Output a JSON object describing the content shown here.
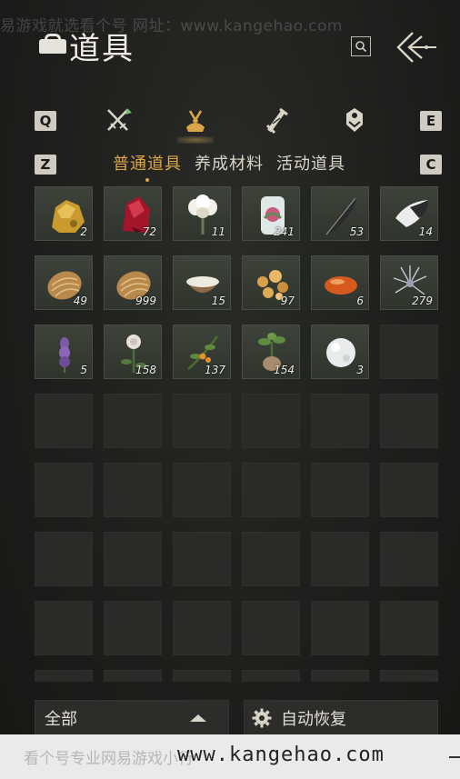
{
  "watermark_top": "易游戏就选看个号    网址：www.kangehao.com",
  "header": {
    "title": "道具"
  },
  "tabs": {
    "key_left": "Q",
    "key_right": "E",
    "key_sub_left": "Z",
    "key_sub_right": "C",
    "categories": [
      {
        "icon": "crossed-swords-icon",
        "active": false
      },
      {
        "icon": "item-bag-icon",
        "active": true
      },
      {
        "icon": "scroll-quill-icon",
        "active": false
      },
      {
        "icon": "crest-icon",
        "active": false
      }
    ],
    "subtabs": [
      "普通道具",
      "养成材料",
      "活动道具"
    ],
    "active_subtab": 0
  },
  "inventory": {
    "items": [
      {
        "icon": "gold-ore-icon",
        "count": "2"
      },
      {
        "icon": "red-crystal-icon",
        "count": "72"
      },
      {
        "icon": "white-flower-icon",
        "count": "11"
      },
      {
        "icon": "jade-vase-icon",
        "count": "241"
      },
      {
        "icon": "black-feather-icon",
        "count": "53"
      },
      {
        "icon": "white-fur-icon",
        "count": "14"
      },
      {
        "icon": "silk-cocoon-icon",
        "count": "49"
      },
      {
        "icon": "silk-cocoon-icon",
        "count": "999"
      },
      {
        "icon": "rice-bowl-icon",
        "count": "15"
      },
      {
        "icon": "amber-pieces-icon",
        "count": "97"
      },
      {
        "icon": "orange-gem-icon",
        "count": "6"
      },
      {
        "icon": "silver-thistle-icon",
        "count": "279"
      },
      {
        "icon": "purple-flower-icon",
        "count": "5"
      },
      {
        "icon": "white-rose-icon",
        "count": "158"
      },
      {
        "icon": "orange-berry-branch-icon",
        "count": "137"
      },
      {
        "icon": "root-herb-icon",
        "count": "154"
      },
      {
        "icon": "snowball-icon",
        "count": "3"
      }
    ]
  },
  "footer": {
    "filter_label": "全部",
    "auto_restore_label": "自动恢复"
  },
  "watermark_bottom": {
    "text1": "看个号专业网易游戏小行",
    "text2": "www.kangehao.com"
  },
  "colors": {
    "accent": "#d9a64a",
    "cell_bg": "#383e35",
    "empty_cell_bg": "#2a2b29"
  }
}
